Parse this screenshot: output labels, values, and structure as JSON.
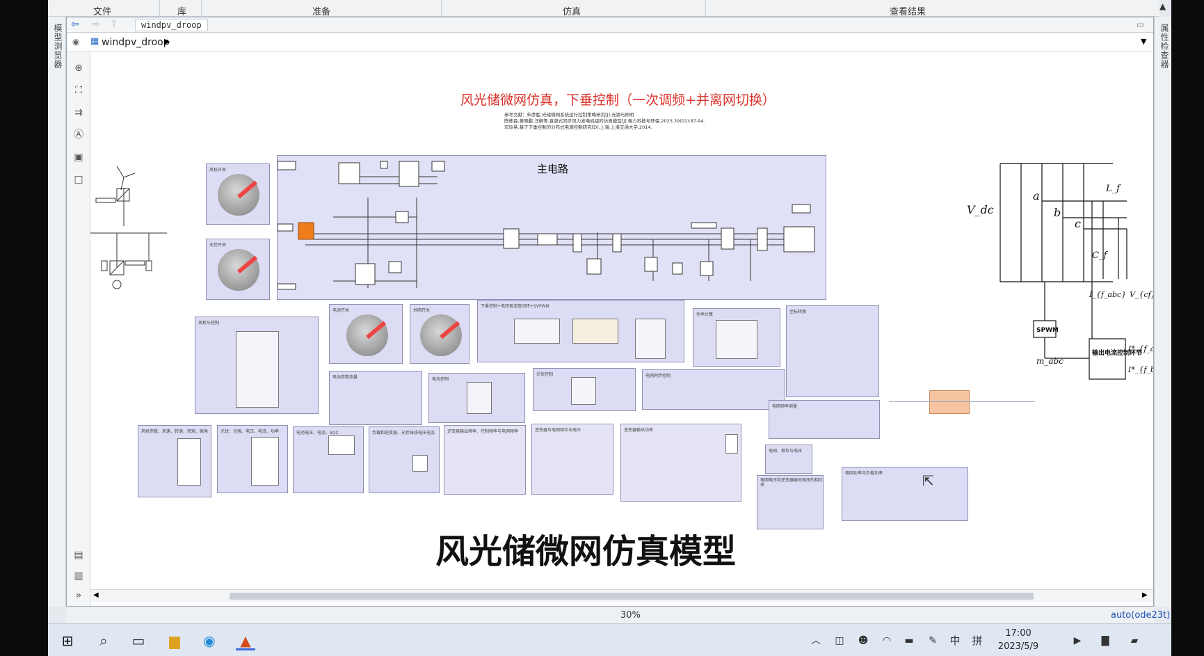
{
  "ribbon": {
    "sections": [
      "文件",
      "库",
      "准备",
      "仿真",
      "查看结果"
    ]
  },
  "left_panel": {
    "label": "模型浏览器"
  },
  "right_panel": {
    "label": "属性检查器"
  },
  "tab": {
    "label": "windpv_droop"
  },
  "address": {
    "model_name": "windpv_droop"
  },
  "canvas": {
    "title": "风光储微网仿真，下垂控制（一次调频+并离网切换）",
    "references": [
      "参考文献：朱彦胜.光储微网系统运行控制策略研究[J].光源与照明",
      "陈栋森,黄晓鹏,汪枫等.直驱式同步风力发电机组的仿真模型[J].电力科技与环保,2023,39(01):87-94.",
      "邓玲慧.基于下垂控制的分布式电源控制研究[D].上海:上海交通大学,2014."
    ],
    "main_circuit_label": "主电路",
    "caption": "风光储微网仿真模型",
    "blocks": [
      {
        "label": "风机开关"
      },
      {
        "label": "光伏开关"
      },
      {
        "label": "风机与控制"
      },
      {
        "label": "电池开关"
      },
      {
        "label": "并网开关"
      },
      {
        "label": "下垂控制+电压电流双闭环+SVPWM"
      },
      {
        "label": "功率计算"
      },
      {
        "label": "坐标转换"
      },
      {
        "label": "电池参数测量"
      },
      {
        "label": "电池控制"
      },
      {
        "label": "光伏控制"
      },
      {
        "label": "电网同步控制"
      },
      {
        "label": "电网频率测量"
      },
      {
        "label": "电网、相位与电压"
      },
      {
        "label": "电网电压和逆变器输出电压的相位差"
      },
      {
        "label": "电网功率与负载功率"
      },
      {
        "label": "风机参数：风速、转速、转矩、桨角"
      },
      {
        "label": "光伏：光强、电压、电流、功率"
      },
      {
        "label": "电池电压、电流、SOC"
      },
      {
        "label": "负载和逆变器、光伏母线电压电流"
      },
      {
        "label": "逆变器输出频率、控制频率与电网频率"
      },
      {
        "label": "逆变器与电网相位与电压"
      },
      {
        "label": "逆变器输出功率"
      }
    ],
    "circuit_labels": {
      "vdc": "V_dc",
      "a": "a",
      "b": "b",
      "c": "c",
      "lf": "L_f",
      "cf": "C_f",
      "iabc": "I_{f_abc}",
      "vcf": "V_{cf}",
      "spwm": "SPWM",
      "mabc": "m_abc",
      "ctrl": "输出电流控制环节",
      "iref_a": "I*_{f_a}",
      "iref_b": "I*_{f_b}",
      "iref_c": "I*_{f_c}"
    }
  },
  "status": {
    "zoom": "30%",
    "solver": "auto(ode23t)"
  },
  "taskbar": {
    "ime_lang": "中",
    "ime_mode": "拼",
    "time": "17:00",
    "date": "2023/5/9"
  },
  "colors": {
    "title_red": "#d9322b",
    "block_fill": "#dcdcf4",
    "taskbar": "#dfe7f2",
    "solver_blue": "#1a4fb5"
  }
}
